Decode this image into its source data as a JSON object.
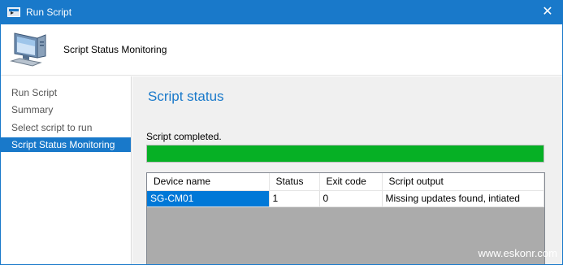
{
  "window": {
    "title": "Run Script",
    "close_label": "✕"
  },
  "header": {
    "title": "Script Status Monitoring",
    "icon": "computer-icon"
  },
  "sidebar": {
    "items": [
      {
        "label": "Run Script",
        "active": false
      },
      {
        "label": "Summary",
        "active": false
      },
      {
        "label": "Select script to run",
        "active": false
      },
      {
        "label": "Script Status Monitoring",
        "active": true
      }
    ]
  },
  "main": {
    "title": "Script status",
    "status_text": "Script completed.",
    "progress_percent": 100,
    "progress_color": "#06b025",
    "table": {
      "columns": [
        "Device name",
        "Status",
        "Exit code",
        "Script output"
      ],
      "rows": [
        [
          "SG-CM01",
          "1",
          "0",
          "Missing updates found, intiated"
        ]
      ]
    }
  },
  "watermark": "www.eskonr.com",
  "colors": {
    "accent": "#1979ca",
    "selection": "#0078d7"
  }
}
